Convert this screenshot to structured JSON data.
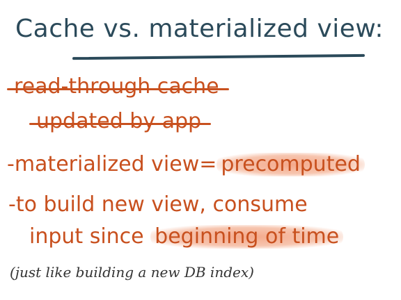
{
  "title": "Cache vs. materialized view:",
  "line1": "read-through cache",
  "line2": "updated by app",
  "line3_prefix": "-materialized view=",
  "line3_highlight": "precomputed",
  "line4": "-to build new view, consume",
  "line5_prefix": "input since ",
  "line5_highlight": "beginning of time",
  "aside": "(just like building a new DB index)"
}
